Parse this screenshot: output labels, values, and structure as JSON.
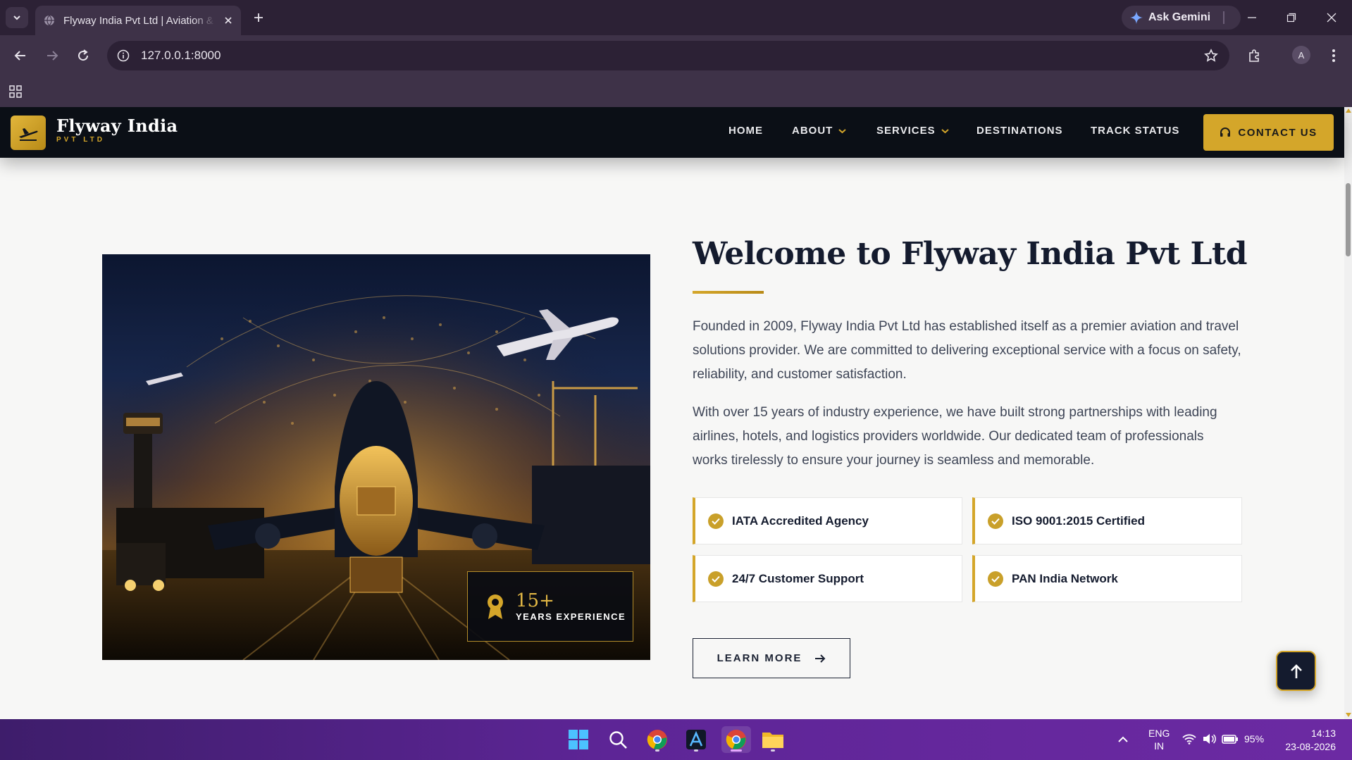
{
  "browser": {
    "tab_title": "Flyway India Pvt Ltd | Aviation & Travel",
    "url": "127.0.0.1:8000",
    "ask_gemini": "Ask Gemini",
    "profile_initial": "A"
  },
  "site": {
    "brand_name": "Flyway India",
    "brand_sub": "PVT LTD",
    "nav": [
      {
        "label": "HOME",
        "dropdown": false
      },
      {
        "label": "ABOUT",
        "dropdown": true
      },
      {
        "label": "SERVICES",
        "dropdown": true
      },
      {
        "label": "DESTINATIONS",
        "dropdown": false
      },
      {
        "label": "TRACK STATUS",
        "dropdown": false
      }
    ],
    "contact_label": "CONTACT US",
    "accent_color": "#d4a62a",
    "dark_color": "#0b0f16"
  },
  "about": {
    "title": "Welcome to Flyway India Pvt Ltd",
    "paragraph1": "Founded in 2009, Flyway India Pvt Ltd has established itself as a premier aviation and travel solutions provider. We are committed to delivering exceptional service with a focus on safety, reliability, and customer satisfaction.",
    "paragraph2": "With over 15 years of industry experience, we have built strong partnerships with leading airlines, hotels, and logistics providers worldwide. Our dedicated team of professionals works tirelessly to ensure your journey is seamless and memorable.",
    "features": [
      "IATA Accredited Agency",
      "ISO 9001:2015 Certified",
      "24/7 Customer Support",
      "PAN India Network"
    ],
    "learn_more": "LEARN MORE",
    "experience_number": "15+",
    "experience_label": "YEARS EXPERIENCE"
  },
  "taskbar": {
    "lang_line1": "ENG",
    "lang_line2": "IN",
    "battery": "95%",
    "time": "14:13",
    "date": "23-08-2026"
  }
}
